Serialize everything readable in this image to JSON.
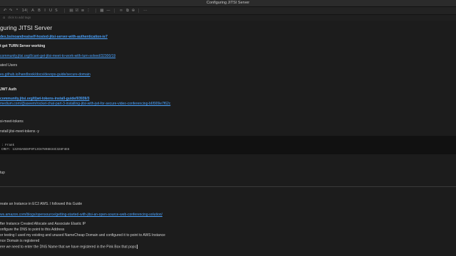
{
  "window": {
    "title": "Configuring JITSI Server"
  },
  "toolbar": {
    "items": [
      {
        "icon": "undo-icon",
        "glyph": "↶"
      },
      {
        "icon": "redo-icon",
        "glyph": "↷"
      },
      {
        "icon": "font-size-icon",
        "glyph": "⁶"
      },
      {
        "icon": "font-size-value",
        "glyph": "14"
      },
      {
        "icon": "text-color-icon",
        "glyph": "A"
      },
      {
        "icon": "bold-icon",
        "glyph": "B"
      },
      {
        "icon": "italic-icon",
        "glyph": "I"
      },
      {
        "icon": "underline-icon",
        "glyph": "U"
      },
      {
        "icon": "strikethrough-icon",
        "glyph": "S"
      },
      {
        "icon": "highlight-icon",
        "glyph": "▤"
      },
      {
        "icon": "checkbox-icon",
        "glyph": "☑"
      },
      {
        "icon": "bullet-list-icon",
        "glyph": "≡"
      },
      {
        "icon": "numbered-list-icon",
        "glyph": "⋮"
      },
      {
        "icon": "table-icon",
        "glyph": "▦"
      },
      {
        "icon": "divider-icon",
        "glyph": "—"
      },
      {
        "icon": "link-icon",
        "glyph": "∞"
      },
      {
        "icon": "attachment-icon",
        "glyph": "⧉"
      },
      {
        "icon": "code-icon",
        "glyph": "⊕"
      },
      {
        "icon": "more-icon",
        "glyph": "⋯"
      }
    ]
  },
  "tags": {
    "placeholder": "click to add tags"
  },
  "note": {
    "heading": "guring JITSI Server",
    "link1": "des.bs/noandrea/self-hosted-jitsi-server-with-authentication-ie7",
    "section_turn": "t get TURN Server working",
    "link2": "community.jitsi.org/t/cant-get-jitsi-meet-to-work-with-turn-solved/32300/19",
    "section_users": "ated Users",
    "link3": "es.github.io/handbook/docs/devops-guide/secure-domain",
    "section_jwt": "JWT Auth",
    "link4": "community.jitsi.org/t/jwt-tokens-install-guide/93939/3",
    "link5": "medium.com/@aseem/rocket-chat-part-3-installing-jitsi-with-jwt-for-secure-video-conferencing-b6f909e7f62c",
    "tokens_label": "si-meet-tokens",
    "install_cmd": "nstall jitsi-meet-tokens -y",
    "code_line1": ": Frank",
    "code_line2": "CRET: 13293A5E8F9F13C87898834C328F4E8",
    "setup_label": "tup",
    "ec2_text": "reate an Instance in EC2 AWS. I followed this Guide",
    "link6": "ws.amazon.com/blogs/opensource/getting-started-with-jitsi-an-open-source-web-conferencing-solution/",
    "step1": "fter Instance Created Allocate and Associate Elastic IP",
    "step2": "onfigure the DNS to point to this Address",
    "step3": "or testing I used my existing and unused NameCheap Domain and configured it to point to AWS Instance",
    "step4": "nce Domain is registered",
    "step5": "ere we need to enter the DNS Name that we have registered in the Pink Box that pops"
  },
  "colors": {
    "background": "#1c1c1c",
    "link": "#4aa3ff",
    "code_bg": "#111111"
  }
}
